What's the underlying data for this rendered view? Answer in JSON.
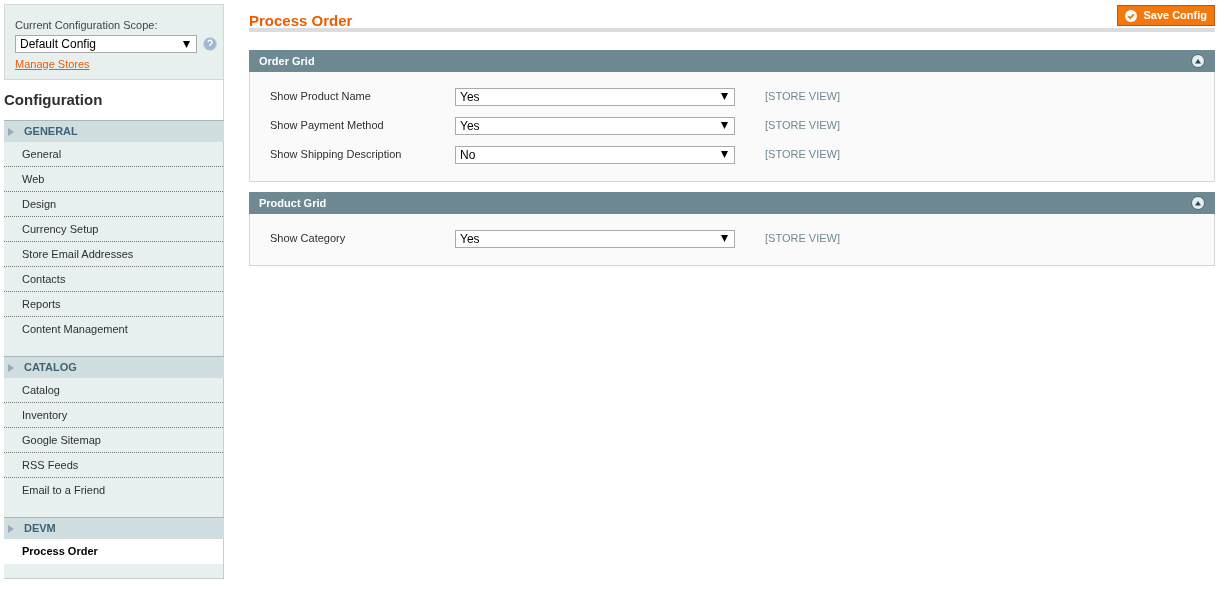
{
  "scope": {
    "label": "Current Configuration Scope:",
    "value": "Default Config",
    "link": "Manage Stores"
  },
  "sidebar": {
    "title": "Configuration",
    "groups": [
      {
        "label": "GENERAL",
        "items": [
          {
            "label": "General",
            "selected": false
          },
          {
            "label": "Web",
            "selected": false
          },
          {
            "label": "Design",
            "selected": false
          },
          {
            "label": "Currency Setup",
            "selected": false
          },
          {
            "label": "Store Email Addresses",
            "selected": false
          },
          {
            "label": "Contacts",
            "selected": false
          },
          {
            "label": "Reports",
            "selected": false
          },
          {
            "label": "Content Management",
            "selected": false
          }
        ]
      },
      {
        "label": "CATALOG",
        "items": [
          {
            "label": "Catalog",
            "selected": false
          },
          {
            "label": "Inventory",
            "selected": false
          },
          {
            "label": "Google Sitemap",
            "selected": false
          },
          {
            "label": "RSS Feeds",
            "selected": false
          },
          {
            "label": "Email to a Friend",
            "selected": false
          }
        ]
      },
      {
        "label": "DEVM",
        "items": [
          {
            "label": "Process Order",
            "selected": true
          }
        ]
      }
    ]
  },
  "page": {
    "title": "Process Order",
    "save_button": "Save Config"
  },
  "sections": [
    {
      "title": "Order Grid",
      "expanded": true,
      "fields": [
        {
          "label": "Show Product Name",
          "value": "Yes",
          "scope": "[STORE VIEW]"
        },
        {
          "label": "Show Payment Method",
          "value": "Yes",
          "scope": "[STORE VIEW]"
        },
        {
          "label": "Show Shipping Description",
          "value": "No",
          "scope": "[STORE VIEW]"
        }
      ]
    },
    {
      "title": "Product Grid",
      "expanded": true,
      "fields": [
        {
          "label": "Show Category",
          "value": "Yes",
          "scope": "[STORE VIEW]"
        }
      ]
    }
  ]
}
